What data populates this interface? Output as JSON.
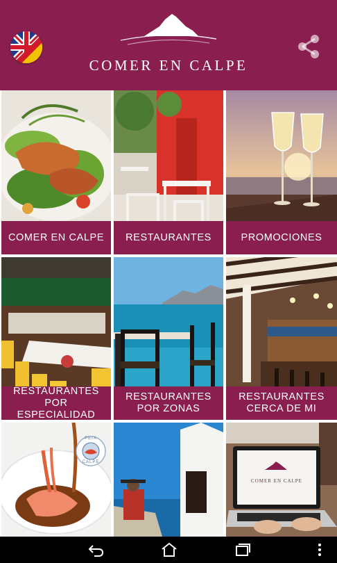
{
  "header": {
    "app_title": "COMER EN CALPE",
    "language_flag_icon": "uk-spain-flag-icon",
    "share_icon": "share-icon",
    "background_color": "#8a1f4f"
  },
  "tiles": [
    {
      "label": "COMER EN CALPE",
      "image": "grilled-prawns-salad"
    },
    {
      "label": "RESTAURANTES",
      "image": "restaurant-terrace"
    },
    {
      "label": "PROMOCIONES",
      "image": "champagne-glasses-sunset"
    },
    {
      "label": "RESTAURANTES\nPOR ESPECIALIDAD",
      "image": "banquet-hall-yellow-chairs"
    },
    {
      "label": "RESTAURANTES\nPOR ZONAS",
      "image": "seaside-table-chairs"
    },
    {
      "label": "RESTAURANTES\nCERCA DE MI",
      "image": "restaurant-bar-interior"
    },
    {
      "label": "",
      "image": "langoustine-dish"
    },
    {
      "label": "",
      "image": "white-chapel-sea"
    },
    {
      "label": "",
      "image": "laptop-comer-en-calpe",
      "laptop_screen_text": "COMER EN CALPE"
    }
  ],
  "badge": {
    "top": "PEIX",
    "bottom": "CALPE"
  },
  "navbar": {
    "back_icon": "back-icon",
    "home_icon": "home-icon",
    "recents_icon": "recents-icon",
    "menu_icon": "overflow-menu-icon"
  },
  "colors": {
    "brand": "#8a1f4f",
    "label_text": "#ffffff"
  }
}
